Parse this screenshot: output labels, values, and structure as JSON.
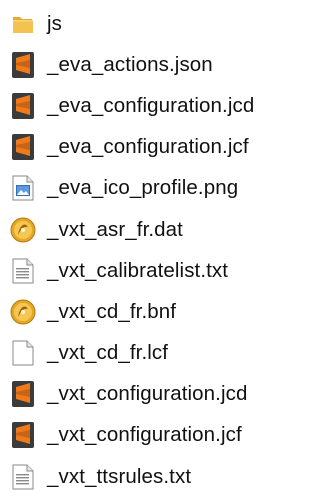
{
  "colors": {
    "folder": "#f3c24f",
    "sublime_orange": "#ef7a1a",
    "sublime_dark": "#3b3b3b",
    "png_blue": "#2f6fb6",
    "gold_disc": "#e5a726",
    "text": "#111111"
  },
  "files": [
    {
      "name": "js",
      "icon": "folder-icon"
    },
    {
      "name": "_eva_actions.json",
      "icon": "sublime-text-icon"
    },
    {
      "name": "_eva_configuration.jcd",
      "icon": "sublime-text-icon"
    },
    {
      "name": "_eva_configuration.jcf",
      "icon": "sublime-text-icon"
    },
    {
      "name": "_eva_ico_profile.png",
      "icon": "image-file-icon"
    },
    {
      "name": "_vxt_asr_fr.dat",
      "icon": "gold-disc-icon"
    },
    {
      "name": "_vxt_calibratelist.txt",
      "icon": "text-file-icon"
    },
    {
      "name": "_vxt_cd_fr.bnf",
      "icon": "gold-disc-icon"
    },
    {
      "name": "_vxt_cd_fr.lcf",
      "icon": "blank-file-icon"
    },
    {
      "name": "_vxt_configuration.jcd",
      "icon": "sublime-text-icon"
    },
    {
      "name": "_vxt_configuration.jcf",
      "icon": "sublime-text-icon"
    },
    {
      "name": "_vxt_ttsrules.txt",
      "icon": "text-file-icon"
    }
  ]
}
